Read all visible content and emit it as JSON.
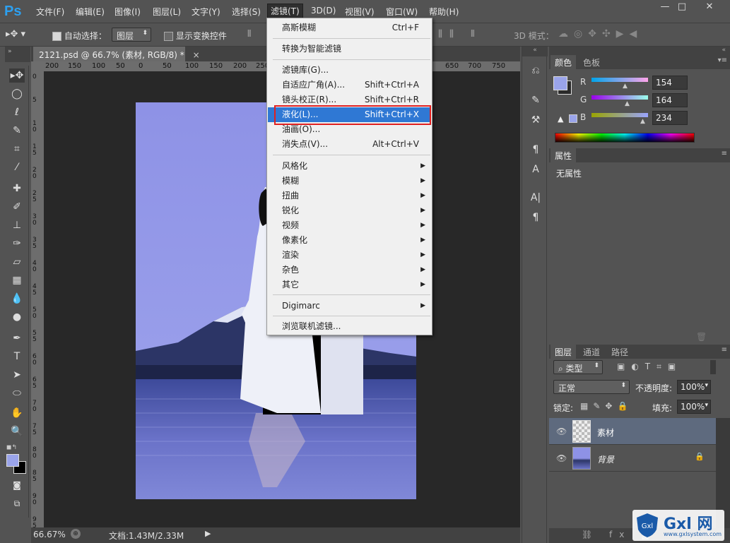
{
  "menubar": {
    "logo": "Ps",
    "items": [
      "文件(F)",
      "编辑(E)",
      "图像(I)",
      "图层(L)",
      "文字(Y)",
      "选择(S)",
      "滤镜(T)",
      "3D(D)",
      "视图(V)",
      "窗口(W)",
      "帮助(H)"
    ],
    "window_controls": [
      "—",
      "□",
      "✕"
    ]
  },
  "options": {
    "auto_select_label": "自动选择：",
    "auto_select_value": "图层",
    "show_transform_label": "显示变换控件",
    "mode_3d_label": "3D 模式："
  },
  "document": {
    "tab_title": "2121.psd @ 66.7% (素材, RGB/8) *",
    "tab_close": "×",
    "ruler_top_ticks": [
      "200",
      "150",
      "100",
      "50",
      "0",
      "50",
      "100",
      "150",
      "200",
      "250",
      "650",
      "700",
      "750"
    ],
    "ruler_left_ticks": [
      "0",
      "5",
      "1 0",
      "1 5",
      "2 0",
      "2 5",
      "3 0",
      "3 5",
      "4 0",
      "4 5",
      "5 0",
      "5 5",
      "6 0",
      "6 5",
      "7 0",
      "7 5",
      "8 0",
      "8 5",
      "9 0",
      "9 5"
    ]
  },
  "status": {
    "zoom": "66.67%",
    "doc_info": "文档:1.43M/2.33M"
  },
  "filter_menu": {
    "items": [
      {
        "label": "高斯模糊",
        "shortcut": "Ctrl+F"
      },
      {
        "label": "转换为智能滤镜",
        "shortcut": ""
      },
      {
        "label": "滤镜库(G)...",
        "shortcut": ""
      },
      {
        "label": "自适应广角(A)...",
        "shortcut": "Shift+Ctrl+A"
      },
      {
        "label": "镜头校正(R)...",
        "shortcut": "Shift+Ctrl+R"
      },
      {
        "label": "液化(L)...",
        "shortcut": "Shift+Ctrl+X"
      },
      {
        "label": "油画(O)...",
        "shortcut": ""
      },
      {
        "label": "消失点(V)...",
        "shortcut": "Alt+Ctrl+V"
      },
      {
        "label": "风格化"
      },
      {
        "label": "模糊"
      },
      {
        "label": "扭曲"
      },
      {
        "label": "锐化"
      },
      {
        "label": "视频"
      },
      {
        "label": "像素化"
      },
      {
        "label": "渲染"
      },
      {
        "label": "杂色"
      },
      {
        "label": "其它"
      },
      {
        "label": "Digimarc"
      },
      {
        "label": "浏览联机滤镜..."
      }
    ]
  },
  "color_panel": {
    "tabs": [
      "颜色",
      "色板"
    ],
    "r_label": "R",
    "r_value": "154",
    "g_label": "G",
    "g_value": "164",
    "b_label": "B",
    "b_value": "234",
    "foreground": "#9aa4ea"
  },
  "properties_panel": {
    "tab": "属性",
    "text": "无属性"
  },
  "layers_panel": {
    "tabs": [
      "图层",
      "通道",
      "路径"
    ],
    "filter_kind": "类型",
    "blend_mode": "正常",
    "opacity_label": "不透明度:",
    "opacity_value": "100%",
    "lock_label": "锁定:",
    "fill_label": "填充:",
    "fill_value": "100%",
    "layers": [
      {
        "name": "素材"
      },
      {
        "name": "背景"
      }
    ]
  },
  "watermark": {
    "brand": "Gxl 网",
    "url": "www.gxlsystem.com"
  }
}
